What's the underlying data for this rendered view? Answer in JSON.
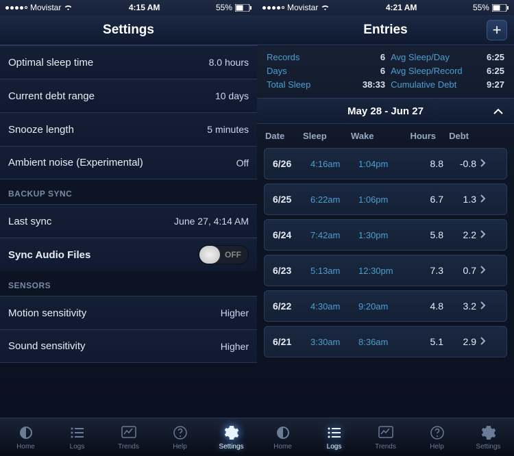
{
  "left": {
    "status": {
      "carrier": "Movistar",
      "time": "4:15 AM",
      "battery": "55%"
    },
    "title": "Settings",
    "rows": [
      {
        "label": "Optimal sleep time",
        "value": "8.0 hours"
      },
      {
        "label": "Current debt range",
        "value": "10 days"
      },
      {
        "label": "Snooze length",
        "value": "5 minutes"
      },
      {
        "label": "Ambient noise (Experimental)",
        "value": "Off"
      }
    ],
    "backup_header": "BACKUP SYNC",
    "backup_rows": {
      "last_sync_label": "Last sync",
      "last_sync_value": "June 27, 4:14 AM",
      "sync_audio_label": "Sync Audio Files",
      "sync_audio_toggle": "OFF"
    },
    "sensors_header": "SENSORS",
    "sensor_rows": [
      {
        "label": "Motion sensitivity",
        "value": "Higher"
      },
      {
        "label": "Sound sensitivity",
        "value": "Higher"
      }
    ],
    "tabs": [
      "Home",
      "Logs",
      "Trends",
      "Help",
      "Settings"
    ],
    "active_tab": 4
  },
  "right": {
    "status": {
      "carrier": "Movistar",
      "time": "4:21 AM",
      "battery": "55%"
    },
    "title": "Entries",
    "summary": {
      "records_label": "Records",
      "records_val": "6",
      "days_label": "Days",
      "days_val": "6",
      "total_label": "Total Sleep",
      "total_val": "38:33",
      "avgday_label": "Avg Sleep/Day",
      "avgday_val": "6:25",
      "avgrec_label": "Avg Sleep/Record",
      "avgrec_val": "6:25",
      "cumdebt_label": "Cumulative Debt",
      "cumdebt_val": "9:27"
    },
    "date_range": "May 28 - Jun 27",
    "columns": [
      "Date",
      "Sleep",
      "Wake",
      "Hours",
      "Debt"
    ],
    "entries": [
      {
        "date": "6/26",
        "sleep": "4:16am",
        "wake": "1:04pm",
        "hours": "8.8",
        "debt": "-0.8"
      },
      {
        "date": "6/25",
        "sleep": "6:22am",
        "wake": "1:06pm",
        "hours": "6.7",
        "debt": "1.3"
      },
      {
        "date": "6/24",
        "sleep": "7:42am",
        "wake": "1:30pm",
        "hours": "5.8",
        "debt": "2.2"
      },
      {
        "date": "6/23",
        "sleep": "5:13am",
        "wake": "12:30pm",
        "hours": "7.3",
        "debt": "0.7"
      },
      {
        "date": "6/22",
        "sleep": "4:30am",
        "wake": "9:20am",
        "hours": "4.8",
        "debt": "3.2"
      },
      {
        "date": "6/21",
        "sleep": "3:30am",
        "wake": "8:36am",
        "hours": "5.1",
        "debt": "2.9"
      }
    ],
    "tabs": [
      "Home",
      "Logs",
      "Trends",
      "Help",
      "Settings"
    ],
    "active_tab": 1
  }
}
